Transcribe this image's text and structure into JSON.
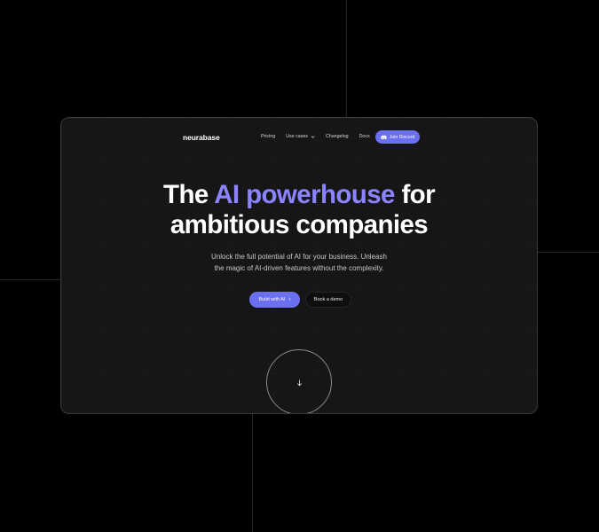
{
  "brand": {
    "name": "neurabase"
  },
  "nav": {
    "items": [
      {
        "label": "Pricing"
      },
      {
        "label": "Use cases"
      },
      {
        "label": "Changelog"
      },
      {
        "label": "Docs"
      }
    ],
    "cta_label": "Join Discord",
    "cta_icon": "discord-icon"
  },
  "hero": {
    "title_pre": "The ",
    "title_accent": "AI powerhouse",
    "title_post": " for",
    "title_line2": "ambitious companies",
    "subtitle_line1": "Unlock the full potential of AI for your business. Unleash",
    "subtitle_line2": "the magic of AI-driven features without the complexity.",
    "primary_label": "Build with AI",
    "primary_arrow": "›",
    "secondary_label": "Book a demo",
    "scroll_icon": "arrow-down-icon"
  },
  "colors": {
    "accent": "#8b83ff",
    "button": "#6b70f2",
    "background": "#000000",
    "panel": "#161616"
  }
}
